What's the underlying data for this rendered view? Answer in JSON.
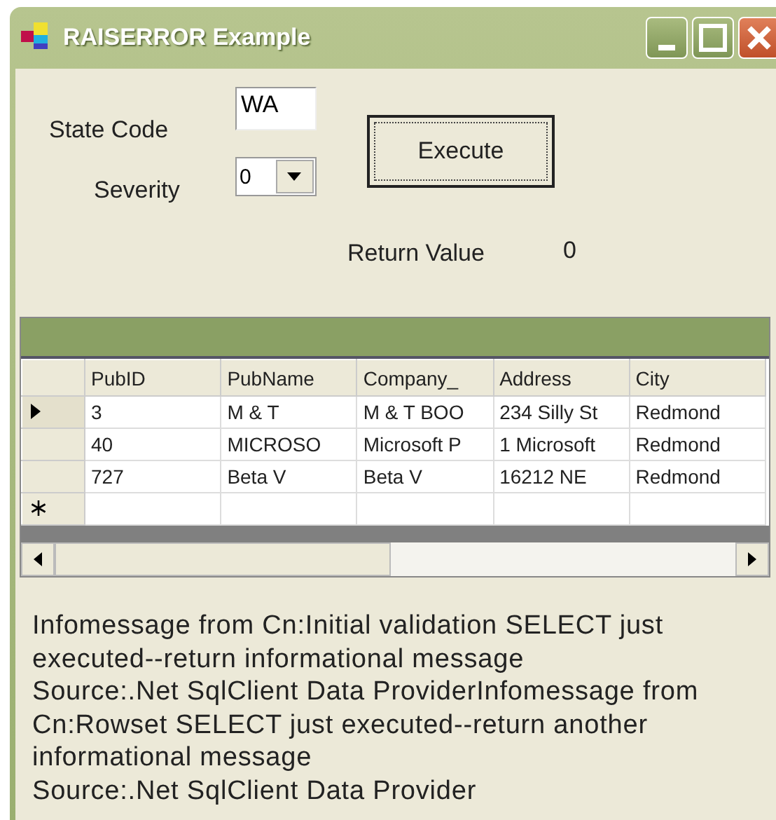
{
  "window": {
    "title": "RAISERROR Example"
  },
  "form": {
    "state_code": {
      "label": "State Code",
      "value": "WA"
    },
    "severity": {
      "label": "Severity",
      "value": "0"
    },
    "execute_button": "Execute",
    "return_value": {
      "label": "Return Value",
      "value": "0"
    }
  },
  "grid": {
    "columns": [
      "PubID",
      "PubName",
      "Company_",
      "Address",
      "City"
    ],
    "rows": [
      {
        "current": true,
        "cells": [
          "3",
          "M & T",
          "M & T BOO",
          "234 Silly St",
          "Redmond"
        ]
      },
      {
        "current": false,
        "cells": [
          "40",
          "MICROSO",
          "Microsoft P",
          "1 Microsoft",
          "Redmond"
        ]
      },
      {
        "current": false,
        "cells": [
          "727",
          "Beta V",
          "Beta V",
          "16212 NE",
          "Redmond"
        ]
      }
    ]
  },
  "messages": [
    "Infomessage from Cn:Initial validation SELECT just executed--return informational message",
    "Source:.Net SqlClient Data ProviderInfomessage from Cn:Rowset SELECT just executed--return another informational message",
    "Source:.Net SqlClient Data Provider"
  ]
}
